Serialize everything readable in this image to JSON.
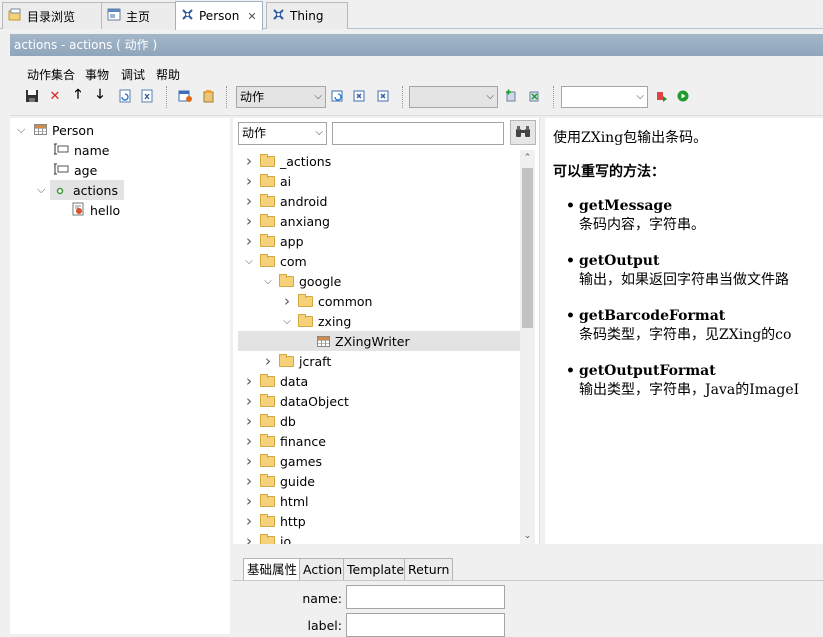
{
  "tabs": [
    {
      "label": "目录浏览",
      "icon": "folder-browse-icon"
    },
    {
      "label": "主页",
      "icon": "home-icon"
    },
    {
      "label": "Person",
      "icon": "thing-editor-icon",
      "active": true,
      "closable": true
    },
    {
      "label": "Thing",
      "icon": "thing-editor-icon"
    }
  ],
  "title": "actions - actions ( 动作 )",
  "menu": [
    "动作集合",
    "事物",
    "调试",
    "帮助"
  ],
  "toolbar": {
    "combo1_value": "动作",
    "combo2_value": "",
    "combo3_value": ""
  },
  "left_tree": {
    "root": "Person",
    "children": [
      "name",
      "age",
      "actions"
    ],
    "grandchild": "hello"
  },
  "mid": {
    "type_value": "动作",
    "search_value": "",
    "rows": [
      {
        "label": "_actions",
        "type": "folder",
        "level": 0,
        "state": "collapsed"
      },
      {
        "label": "ai",
        "type": "folder",
        "level": 0,
        "state": "collapsed"
      },
      {
        "label": "android",
        "type": "folder",
        "level": 0,
        "state": "collapsed"
      },
      {
        "label": "anxiang",
        "type": "folder",
        "level": 0,
        "state": "collapsed"
      },
      {
        "label": "app",
        "type": "folder",
        "level": 0,
        "state": "collapsed"
      },
      {
        "label": "com",
        "type": "folder",
        "level": 0,
        "state": "expanded"
      },
      {
        "label": "google",
        "type": "folder",
        "level": 1,
        "state": "expanded"
      },
      {
        "label": "common",
        "type": "folder",
        "level": 2,
        "state": "collapsed"
      },
      {
        "label": "zxing",
        "type": "folder",
        "level": 2,
        "state": "expanded"
      },
      {
        "label": "ZXingWriter",
        "type": "thing",
        "level": 3,
        "state": "leaf",
        "selected": true
      },
      {
        "label": "jcraft",
        "type": "folder",
        "level": 1,
        "state": "collapsed"
      },
      {
        "label": "data",
        "type": "folder",
        "level": 0,
        "state": "collapsed"
      },
      {
        "label": "dataObject",
        "type": "folder",
        "level": 0,
        "state": "collapsed"
      },
      {
        "label": "db",
        "type": "folder",
        "level": 0,
        "state": "collapsed"
      },
      {
        "label": "finance",
        "type": "folder",
        "level": 0,
        "state": "collapsed"
      },
      {
        "label": "games",
        "type": "folder",
        "level": 0,
        "state": "collapsed"
      },
      {
        "label": "guide",
        "type": "folder",
        "level": 0,
        "state": "collapsed"
      },
      {
        "label": "html",
        "type": "folder",
        "level": 0,
        "state": "collapsed"
      },
      {
        "label": "http",
        "type": "folder",
        "level": 0,
        "state": "collapsed"
      },
      {
        "label": "io",
        "type": "folder",
        "level": 0,
        "state": "collapsed"
      }
    ]
  },
  "doc": {
    "intro": "使用ZXing包输出条码。",
    "heading": "可以重写的方法：",
    "methods": [
      {
        "name": "getMessage",
        "desc": "条码内容，字符串。"
      },
      {
        "name": "getOutput",
        "desc": "输出，如果返回字符串当做文件路"
      },
      {
        "name": "getBarcodeFormat",
        "desc": "条码类型，字符串，见ZXing的co"
      },
      {
        "name": "getOutputFormat",
        "desc": "输出类型，字符串，Java的ImageI"
      }
    ]
  },
  "bottom": {
    "tabs": [
      "基础属性",
      "Action",
      "Template",
      "Return"
    ],
    "fields": [
      {
        "label": "name:",
        "value": ""
      },
      {
        "label": "label:",
        "value": ""
      }
    ]
  }
}
